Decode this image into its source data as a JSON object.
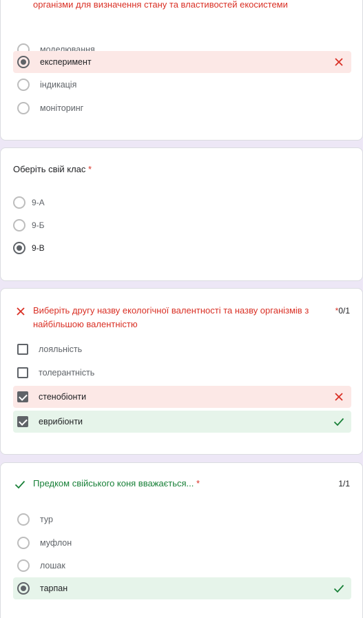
{
  "q1": {
    "title": "організми для визначення стану та властивостей екосистеми",
    "options": [
      {
        "label": "моделювання",
        "selected": false,
        "state": "none"
      },
      {
        "label": "експеримент",
        "selected": true,
        "state": "wrong"
      },
      {
        "label": "індикація",
        "selected": false,
        "state": "none"
      },
      {
        "label": "моніторинг",
        "selected": false,
        "state": "none"
      }
    ]
  },
  "q2": {
    "title": "Оберіть свій клас",
    "required_mark": "*",
    "options": [
      {
        "label": "9-А",
        "selected": false
      },
      {
        "label": "9-Б",
        "selected": false
      },
      {
        "label": "9-В",
        "selected": true
      }
    ]
  },
  "q3": {
    "title_line1": "Виберіть другу назву екологічної валентності та назву організмів з",
    "title_line2": "найбільшою валентністю",
    "score_star": "*",
    "score": "0/1",
    "options": [
      {
        "label": "лояльність",
        "checked": false,
        "state": "none"
      },
      {
        "label": "толерантність",
        "checked": false,
        "state": "none"
      },
      {
        "label": "стенобіонти",
        "checked": true,
        "state": "wrong"
      },
      {
        "label": "еврибіонти",
        "checked": true,
        "state": "right"
      }
    ]
  },
  "q4": {
    "title": "Предком свійського коня вважається...",
    "required_mark": "*",
    "score": "1/1",
    "options": [
      {
        "label": "тур",
        "selected": false,
        "state": "none"
      },
      {
        "label": "муфлон",
        "selected": false,
        "state": "none"
      },
      {
        "label": "лошак",
        "selected": false,
        "state": "none"
      },
      {
        "label": "тарпан",
        "selected": true,
        "state": "right"
      }
    ]
  },
  "colors": {
    "wrong": "#d93025",
    "right": "#188038",
    "wrong_bg": "#fce8e6",
    "right_bg": "#e6f4ea",
    "page_bg": "#ede7f6"
  },
  "icons": {
    "wrong": "close-icon",
    "right": "check-icon"
  }
}
